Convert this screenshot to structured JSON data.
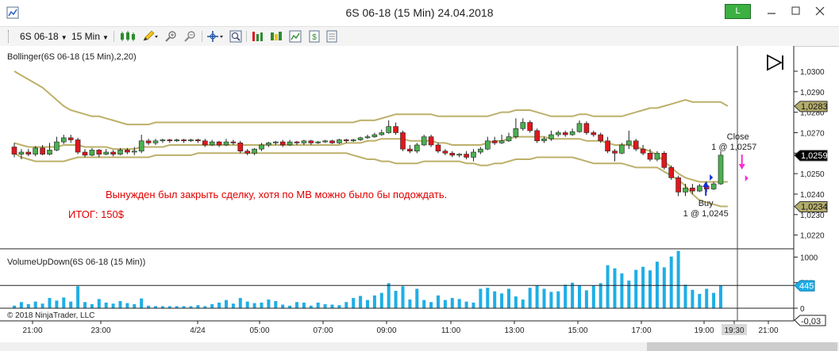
{
  "window": {
    "title": "6S 06-18 (15 Min)  24.04.2018",
    "link_indicator": "L",
    "minimize_icon": "minimize-icon",
    "maximize_icon": "maximize-icon",
    "close_icon": "close-icon"
  },
  "toolbar": {
    "instrument": "6S 06-18",
    "interval": "15 Min",
    "icons": [
      "candlestick-style-icon",
      "pencil-draw-icon",
      "zoom-in-icon",
      "zoom-out-icon",
      "crosshair-icon",
      "magnifier-icon",
      "data-series-icon",
      "strategies-icon",
      "chart-properties-icon",
      "order-entry-icon",
      "properties-icon"
    ]
  },
  "price_panel": {
    "indicator_label": "Bollinger(6S 06-18 (15 Min),2,20)",
    "annotation_line1": "Вынужден был закрыть сделку, хотя по МВ  можно было бы подождать.",
    "annotation_line2": "ИТОГ: 150$",
    "exit_label": "Close",
    "exit_detail": "1 @ 1,0257",
    "entry_label": "Buy",
    "entry_detail": "1 @ 1,0245",
    "price_ticks": [
      "1,0300",
      "1,0290",
      "1,0280",
      "1,0270",
      "1,0260",
      "1,0250",
      "1,0240",
      "1,0230",
      "1,0220"
    ],
    "price_markers": [
      {
        "text": "1,0283",
        "value": 1.0283
      },
      {
        "text": "1,0259",
        "value": 1.0259
      },
      {
        "text": "1,0234",
        "value": 1.0234
      }
    ],
    "play_icon": "play-to-end-icon"
  },
  "volume_panel": {
    "indicator_label": "VolumeUpDown(6S 06-18 (15 Min))",
    "ticks": [
      "1000",
      "500",
      "0"
    ],
    "marker": "445",
    "copyright": "© 2018 NinjaTrader, LLC",
    "bottom_value": "-0,03"
  },
  "time_axis": {
    "labels": [
      "21:00",
      "23:00",
      "4/24",
      "05:00",
      "07:00",
      "09:00",
      "11:00",
      "13:00",
      "15:00",
      "17:00",
      "19:00",
      "19:30",
      "21:00"
    ],
    "highlight": "19:30"
  },
  "colors": {
    "up_candle": "#4caf50",
    "down_candle": "#e0171d",
    "bollinger": "#bdb06a",
    "volume": "#1eaee6",
    "annotation": "#e00000",
    "exit_arrow": "#ff2ad0",
    "entry_arrow": "#1030d8"
  },
  "chart_data": {
    "type": "candlestick",
    "instrument": "6S 06-18",
    "interval": "15 Min",
    "ylim": [
      1.0216,
      1.0305
    ],
    "volume_ylim": [
      0,
      1100
    ],
    "candles": [
      {
        "o": 1.0263,
        "c": 1.02595,
        "h": 1.0265,
        "l": 1.0258,
        "v": 50
      },
      {
        "o": 1.02595,
        "c": 1.02605,
        "h": 1.0262,
        "l": 1.0257,
        "v": 120
      },
      {
        "o": 1.02605,
        "c": 1.02595,
        "h": 1.0262,
        "l": 1.02585,
        "v": 80
      },
      {
        "o": 1.02595,
        "c": 1.02625,
        "h": 1.02635,
        "l": 1.02585,
        "v": 130
      },
      {
        "o": 1.02625,
        "c": 1.02595,
        "h": 1.0264,
        "l": 1.0259,
        "v": 90
      },
      {
        "o": 1.02595,
        "c": 1.02615,
        "h": 1.0265,
        "l": 1.0259,
        "v": 200
      },
      {
        "o": 1.02615,
        "c": 1.02655,
        "h": 1.0268,
        "l": 1.0261,
        "v": 150
      },
      {
        "o": 1.02655,
        "c": 1.02675,
        "h": 1.0269,
        "l": 1.02645,
        "v": 210
      },
      {
        "o": 1.02675,
        "c": 1.02665,
        "h": 1.0269,
        "l": 1.0265,
        "v": 130
      },
      {
        "o": 1.02665,
        "c": 1.02605,
        "h": 1.02675,
        "l": 1.02595,
        "v": 430
      },
      {
        "o": 1.02605,
        "c": 1.0259,
        "h": 1.0262,
        "l": 1.0258,
        "v": 120
      },
      {
        "o": 1.0259,
        "c": 1.02615,
        "h": 1.02625,
        "l": 1.02585,
        "v": 80
      },
      {
        "o": 1.02615,
        "c": 1.02595,
        "h": 1.0262,
        "l": 1.0258,
        "v": 180
      },
      {
        "o": 1.02595,
        "c": 1.02605,
        "h": 1.0262,
        "l": 1.0259,
        "v": 110
      },
      {
        "o": 1.02605,
        "c": 1.02595,
        "h": 1.02615,
        "l": 1.02585,
        "v": 90
      },
      {
        "o": 1.02595,
        "c": 1.02615,
        "h": 1.02625,
        "l": 1.0259,
        "v": 140
      },
      {
        "o": 1.02615,
        "c": 1.02605,
        "h": 1.02625,
        "l": 1.02595,
        "v": 100
      },
      {
        "o": 1.02605,
        "c": 1.0261,
        "h": 1.0263,
        "l": 1.0259,
        "v": 80
      },
      {
        "o": 1.0261,
        "c": 1.0266,
        "h": 1.0269,
        "l": 1.026,
        "v": 190
      },
      {
        "o": 1.0266,
        "c": 1.0265,
        "h": 1.0267,
        "l": 1.0264,
        "v": 50
      },
      {
        "o": 1.0265,
        "c": 1.0266,
        "h": 1.0267,
        "l": 1.0264,
        "v": 40
      },
      {
        "o": 1.0266,
        "c": 1.02665,
        "h": 1.0267,
        "l": 1.0265,
        "v": 40
      },
      {
        "o": 1.02665,
        "c": 1.0266,
        "h": 1.0267,
        "l": 1.0265,
        "v": 40
      },
      {
        "o": 1.0266,
        "c": 1.02665,
        "h": 1.0267,
        "l": 1.02655,
        "v": 40
      },
      {
        "o": 1.02665,
        "c": 1.0266,
        "h": 1.0267,
        "l": 1.0265,
        "v": 40
      },
      {
        "o": 1.0266,
        "c": 1.02665,
        "h": 1.0267,
        "l": 1.02655,
        "v": 40
      },
      {
        "o": 1.02665,
        "c": 1.0266,
        "h": 1.0267,
        "l": 1.0265,
        "v": 60
      },
      {
        "o": 1.0266,
        "c": 1.0264,
        "h": 1.0267,
        "l": 1.0263,
        "v": 40
      },
      {
        "o": 1.0264,
        "c": 1.02655,
        "h": 1.02665,
        "l": 1.02635,
        "v": 80
      },
      {
        "o": 1.02655,
        "c": 1.0264,
        "h": 1.0266,
        "l": 1.0263,
        "v": 110
      },
      {
        "o": 1.0264,
        "c": 1.02655,
        "h": 1.0267,
        "l": 1.02635,
        "v": 160
      },
      {
        "o": 1.02655,
        "c": 1.0265,
        "h": 1.02665,
        "l": 1.0264,
        "v": 90
      },
      {
        "o": 1.0265,
        "c": 1.0261,
        "h": 1.0266,
        "l": 1.026,
        "v": 200
      },
      {
        "o": 1.0261,
        "c": 1.026,
        "h": 1.0262,
        "l": 1.0259,
        "v": 130
      },
      {
        "o": 1.026,
        "c": 1.0262,
        "h": 1.02625,
        "l": 1.0259,
        "v": 100
      },
      {
        "o": 1.0262,
        "c": 1.0264,
        "h": 1.0265,
        "l": 1.0261,
        "v": 110
      },
      {
        "o": 1.0264,
        "c": 1.0265,
        "h": 1.02655,
        "l": 1.0263,
        "v": 170
      },
      {
        "o": 1.0265,
        "c": 1.02655,
        "h": 1.0266,
        "l": 1.0264,
        "v": 140
      },
      {
        "o": 1.02655,
        "c": 1.0264,
        "h": 1.02665,
        "l": 1.0263,
        "v": 70
      },
      {
        "o": 1.0264,
        "c": 1.02655,
        "h": 1.02665,
        "l": 1.02635,
        "v": 50
      },
      {
        "o": 1.02655,
        "c": 1.0265,
        "h": 1.0266,
        "l": 1.0264,
        "v": 120
      },
      {
        "o": 1.0265,
        "c": 1.0266,
        "h": 1.02665,
        "l": 1.0264,
        "v": 110
      },
      {
        "o": 1.0266,
        "c": 1.0265,
        "h": 1.02665,
        "l": 1.0264,
        "v": 50
      },
      {
        "o": 1.0265,
        "c": 1.02655,
        "h": 1.0266,
        "l": 1.02645,
        "v": 110
      },
      {
        "o": 1.02655,
        "c": 1.0266,
        "h": 1.02665,
        "l": 1.0265,
        "v": 80
      },
      {
        "o": 1.0266,
        "c": 1.0265,
        "h": 1.02665,
        "l": 1.02645,
        "v": 70
      },
      {
        "o": 1.0265,
        "c": 1.02665,
        "h": 1.0267,
        "l": 1.02645,
        "v": 60
      },
      {
        "o": 1.02665,
        "c": 1.0266,
        "h": 1.0267,
        "l": 1.0265,
        "v": 120
      },
      {
        "o": 1.0266,
        "c": 1.02665,
        "h": 1.0267,
        "l": 1.02655,
        "v": 200
      },
      {
        "o": 1.02665,
        "c": 1.02675,
        "h": 1.0268,
        "l": 1.0266,
        "v": 240
      },
      {
        "o": 1.02675,
        "c": 1.0268,
        "h": 1.0269,
        "l": 1.0267,
        "v": 160
      },
      {
        "o": 1.0268,
        "c": 1.0269,
        "h": 1.027,
        "l": 1.02675,
        "v": 250
      },
      {
        "o": 1.0269,
        "c": 1.027,
        "h": 1.02715,
        "l": 1.02685,
        "v": 300
      },
      {
        "o": 1.027,
        "c": 1.0273,
        "h": 1.0276,
        "l": 1.02695,
        "v": 490
      },
      {
        "o": 1.0273,
        "c": 1.027,
        "h": 1.0275,
        "l": 1.0269,
        "v": 340
      },
      {
        "o": 1.027,
        "c": 1.0262,
        "h": 1.0271,
        "l": 1.0261,
        "v": 430
      },
      {
        "o": 1.0262,
        "c": 1.0261,
        "h": 1.0264,
        "l": 1.026,
        "v": 170
      },
      {
        "o": 1.0261,
        "c": 1.0264,
        "h": 1.0265,
        "l": 1.026,
        "v": 380
      },
      {
        "o": 1.0264,
        "c": 1.0268,
        "h": 1.0269,
        "l": 1.02635,
        "v": 160
      },
      {
        "o": 1.0268,
        "c": 1.0264,
        "h": 1.0269,
        "l": 1.0263,
        "v": 120
      },
      {
        "o": 1.0264,
        "c": 1.0261,
        "h": 1.0265,
        "l": 1.026,
        "v": 250
      },
      {
        "o": 1.0261,
        "c": 1.026,
        "h": 1.0262,
        "l": 1.0259,
        "v": 160
      },
      {
        "o": 1.026,
        "c": 1.0259,
        "h": 1.0261,
        "l": 1.0258,
        "v": 200
      },
      {
        "o": 1.0259,
        "c": 1.02595,
        "h": 1.026,
        "l": 1.0258,
        "v": 180
      },
      {
        "o": 1.02595,
        "c": 1.0258,
        "h": 1.0261,
        "l": 1.0257,
        "v": 130
      },
      {
        "o": 1.0258,
        "c": 1.02605,
        "h": 1.0262,
        "l": 1.0256,
        "v": 110
      },
      {
        "o": 1.02605,
        "c": 1.0262,
        "h": 1.0263,
        "l": 1.02595,
        "v": 380
      },
      {
        "o": 1.0262,
        "c": 1.0266,
        "h": 1.0268,
        "l": 1.02615,
        "v": 400
      },
      {
        "o": 1.0266,
        "c": 1.0265,
        "h": 1.0268,
        "l": 1.0264,
        "v": 330
      },
      {
        "o": 1.0265,
        "c": 1.0266,
        "h": 1.0269,
        "l": 1.02645,
        "v": 290
      },
      {
        "o": 1.0266,
        "c": 1.0268,
        "h": 1.027,
        "l": 1.02655,
        "v": 380
      },
      {
        "o": 1.0268,
        "c": 1.0272,
        "h": 1.0277,
        "l": 1.0267,
        "v": 230
      },
      {
        "o": 1.0272,
        "c": 1.0275,
        "h": 1.0277,
        "l": 1.0271,
        "v": 170
      },
      {
        "o": 1.0275,
        "c": 1.0271,
        "h": 1.0276,
        "l": 1.027,
        "v": 400
      },
      {
        "o": 1.0271,
        "c": 1.0266,
        "h": 1.0272,
        "l": 1.0265,
        "v": 440
      },
      {
        "o": 1.0266,
        "c": 1.0267,
        "h": 1.0268,
        "l": 1.0265,
        "v": 380
      },
      {
        "o": 1.0267,
        "c": 1.0269,
        "h": 1.0271,
        "l": 1.0266,
        "v": 320
      },
      {
        "o": 1.0269,
        "c": 1.027,
        "h": 1.0271,
        "l": 1.0268,
        "v": 330
      },
      {
        "o": 1.027,
        "c": 1.0269,
        "h": 1.0271,
        "l": 1.0268,
        "v": 460
      },
      {
        "o": 1.0269,
        "c": 1.02705,
        "h": 1.0272,
        "l": 1.02685,
        "v": 500
      },
      {
        "o": 1.02705,
        "c": 1.02745,
        "h": 1.0276,
        "l": 1.027,
        "v": 440
      },
      {
        "o": 1.02745,
        "c": 1.027,
        "h": 1.02755,
        "l": 1.0269,
        "v": 350
      },
      {
        "o": 1.027,
        "c": 1.0269,
        "h": 1.0271,
        "l": 1.0268,
        "v": 440
      },
      {
        "o": 1.0269,
        "c": 1.0266,
        "h": 1.027,
        "l": 1.0265,
        "v": 490
      },
      {
        "o": 1.0266,
        "c": 1.0261,
        "h": 1.0268,
        "l": 1.026,
        "v": 840
      },
      {
        "o": 1.0261,
        "c": 1.026,
        "h": 1.0262,
        "l": 1.0256,
        "v": 780
      },
      {
        "o": 1.026,
        "c": 1.0264,
        "h": 1.0265,
        "l": 1.02595,
        "v": 680
      },
      {
        "o": 1.0264,
        "c": 1.0266,
        "h": 1.0271,
        "l": 1.0262,
        "v": 540
      },
      {
        "o": 1.0266,
        "c": 1.0262,
        "h": 1.0267,
        "l": 1.0261,
        "v": 750
      },
      {
        "o": 1.0262,
        "c": 1.026,
        "h": 1.0264,
        "l": 1.0259,
        "v": 810
      },
      {
        "o": 1.026,
        "c": 1.0257,
        "h": 1.0262,
        "l": 1.0256,
        "v": 740
      },
      {
        "o": 1.0257,
        "c": 1.026,
        "h": 1.0261,
        "l": 1.0256,
        "v": 910
      },
      {
        "o": 1.026,
        "c": 1.0253,
        "h": 1.0261,
        "l": 1.0252,
        "v": 800
      },
      {
        "o": 1.0253,
        "c": 1.0248,
        "h": 1.0254,
        "l": 1.0247,
        "v": 1010
      },
      {
        "o": 1.0248,
        "c": 1.0241,
        "h": 1.0249,
        "l": 1.0239,
        "v": 1120
      },
      {
        "o": 1.0241,
        "c": 1.0243,
        "h": 1.0245,
        "l": 1.0239,
        "v": 460
      },
      {
        "o": 1.0243,
        "c": 1.02415,
        "h": 1.0245,
        "l": 1.024,
        "v": 360
      },
      {
        "o": 1.02415,
        "c": 1.0244,
        "h": 1.0245,
        "l": 1.0241,
        "v": 280
      },
      {
        "o": 1.0244,
        "c": 1.02425,
        "h": 1.0246,
        "l": 1.0241,
        "v": 380
      },
      {
        "o": 1.02425,
        "c": 1.0245,
        "h": 1.0246,
        "l": 1.0242,
        "v": 300
      },
      {
        "o": 1.0245,
        "c": 1.0259,
        "h": 1.0261,
        "l": 1.02445,
        "v": 445
      }
    ],
    "bollinger_upper": [
      1.03,
      1.0298,
      1.0296,
      1.0294,
      1.0292,
      1.0289,
      1.0286,
      1.0283,
      1.0281,
      1.028,
      1.0279,
      1.0278,
      1.0278,
      1.0277,
      1.0276,
      1.0275,
      1.0274,
      1.0274,
      1.0274,
      1.0274,
      1.0275,
      1.0275,
      1.0275,
      1.0275,
      1.0275,
      1.0275,
      1.0275,
      1.0275,
      1.0275,
      1.0275,
      1.0275,
      1.0275,
      1.0275,
      1.0275,
      1.0275,
      1.0275,
      1.0275,
      1.0275,
      1.0275,
      1.0275,
      1.0275,
      1.0275,
      1.0275,
      1.0275,
      1.0275,
      1.0275,
      1.0275,
      1.0275,
      1.0275,
      1.0276,
      1.0276,
      1.0276,
      1.0277,
      1.0278,
      1.0279,
      1.0279,
      1.0279,
      1.0279,
      1.0279,
      1.0279,
      1.0278,
      1.0278,
      1.0278,
      1.0278,
      1.0278,
      1.0278,
      1.0278,
      1.0278,
      1.0279,
      1.028,
      1.028,
      1.0281,
      1.0281,
      1.0281,
      1.028,
      1.0279,
      1.0278,
      1.0278,
      1.0278,
      1.0278,
      1.0279,
      1.0279,
      1.0278,
      1.0278,
      1.0278,
      1.0278,
      1.0278,
      1.0279,
      1.028,
      1.0281,
      1.0282,
      1.0282,
      1.0283,
      1.0284,
      1.0285,
      1.0286,
      1.0285,
      1.0285,
      1.0285,
      1.0285,
      1.0285,
      1.0283
    ],
    "bollinger_middle": [
      1.0265,
      1.0264,
      1.0263,
      1.0263,
      1.0263,
      1.0263,
      1.0263,
      1.0264,
      1.0264,
      1.0264,
      1.0263,
      1.0263,
      1.0263,
      1.0263,
      1.0262,
      1.0262,
      1.0262,
      1.0262,
      1.0263,
      1.0263,
      1.0263,
      1.0263,
      1.0264,
      1.0264,
      1.0264,
      1.0264,
      1.0264,
      1.0264,
      1.0264,
      1.0264,
      1.0264,
      1.0264,
      1.0264,
      1.0264,
      1.0264,
      1.0264,
      1.0264,
      1.0264,
      1.0264,
      1.0264,
      1.0264,
      1.0264,
      1.0264,
      1.0264,
      1.0264,
      1.0264,
      1.0264,
      1.0265,
      1.0265,
      1.0265,
      1.0266,
      1.0266,
      1.0267,
      1.0267,
      1.0267,
      1.0267,
      1.0266,
      1.0266,
      1.0266,
      1.0266,
      1.0265,
      1.0265,
      1.0264,
      1.0264,
      1.0264,
      1.0264,
      1.0264,
      1.0265,
      1.0266,
      1.0266,
      1.0267,
      1.0268,
      1.0268,
      1.0268,
      1.0268,
      1.0268,
      1.0267,
      1.0267,
      1.0267,
      1.0267,
      1.0267,
      1.0266,
      1.0266,
      1.0266,
      1.0265,
      1.0264,
      1.0264,
      1.0264,
      1.0263,
      1.0262,
      1.0261,
      1.0259,
      1.0256,
      1.0253,
      1.025,
      1.0248,
      1.0247,
      1.0246,
      1.0246,
      1.0246,
      1.0246,
      1.0246
    ],
    "bollinger_lower": [
      1.026,
      1.0258,
      1.0257,
      1.0256,
      1.0256,
      1.0256,
      1.0256,
      1.0256,
      1.0257,
      1.0258,
      1.0258,
      1.0258,
      1.0258,
      1.0258,
      1.0258,
      1.0258,
      1.0258,
      1.0258,
      1.0258,
      1.0258,
      1.0259,
      1.0259,
      1.0259,
      1.0259,
      1.0259,
      1.0259,
      1.026,
      1.026,
      1.026,
      1.026,
      1.026,
      1.026,
      1.026,
      1.026,
      1.026,
      1.026,
      1.026,
      1.026,
      1.026,
      1.026,
      1.026,
      1.026,
      1.026,
      1.026,
      1.026,
      1.026,
      1.026,
      1.026,
      1.0259,
      1.0258,
      1.0257,
      1.0257,
      1.0256,
      1.0256,
      1.0255,
      1.0255,
      1.0255,
      1.0255,
      1.0256,
      1.0256,
      1.0256,
      1.0256,
      1.0256,
      1.0256,
      1.0255,
      1.0255,
      1.0254,
      1.0254,
      1.0255,
      1.0255,
      1.0256,
      1.0257,
      1.0257,
      1.0257,
      1.0258,
      1.0258,
      1.0258,
      1.0258,
      1.0258,
      1.0258,
      1.0257,
      1.0256,
      1.0255,
      1.0255,
      1.0255,
      1.0255,
      1.0255,
      1.0254,
      1.0253,
      1.0253,
      1.0253,
      1.0253,
      1.0251,
      1.0249,
      1.0247,
      1.0244,
      1.024,
      1.0237,
      1.0236,
      1.0235,
      1.0234,
      1.0234
    ],
    "entry": {
      "bar": 98,
      "price": 1.0245,
      "label": "Buy",
      "qty": 1
    },
    "exit": {
      "bar": 103,
      "price": 1.0257,
      "label": "Close",
      "qty": 1
    },
    "volume_axis_ticks": [
      1000,
      500,
      0
    ],
    "last_volume": 445
  }
}
